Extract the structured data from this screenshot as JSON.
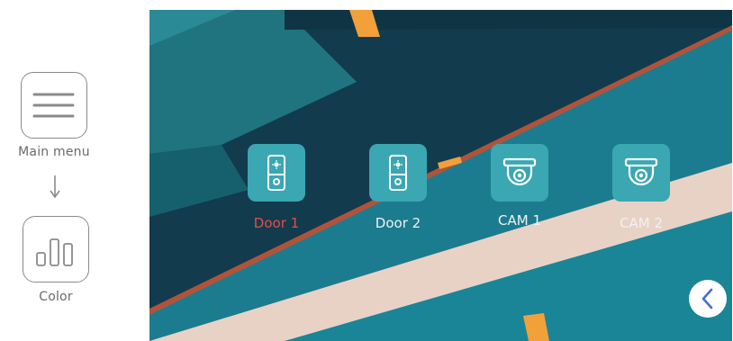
{
  "instructions": {
    "main_menu_label": "Main menu",
    "color_label": "Color",
    "main_menu_icon": "hamburger-menu-icon",
    "color_icon": "bar-levels-icon",
    "arrow_icon": "arrow-down-icon"
  },
  "screen": {
    "devices": [
      {
        "label": "Door 1",
        "icon": "door-station-icon",
        "selected": true
      },
      {
        "label": "Door 2",
        "icon": "door-station-icon",
        "selected": false
      },
      {
        "label": "CAM 1",
        "icon": "dome-camera-icon",
        "selected": false
      },
      {
        "label": "CAM 2",
        "icon": "dome-camera-icon",
        "selected": false
      }
    ],
    "back_icon": "chevron-left-icon"
  },
  "colors": {
    "tile": "#3aa7b2",
    "selected_label": "#e0504a",
    "label": "#f1f1f1",
    "back_chevron": "#3f6fd8",
    "background_dark": "#123b4d",
    "background_teal": "#1b7c8f",
    "accent_stripe": "#f2a03a",
    "beige_band": "#e8d2c6"
  }
}
